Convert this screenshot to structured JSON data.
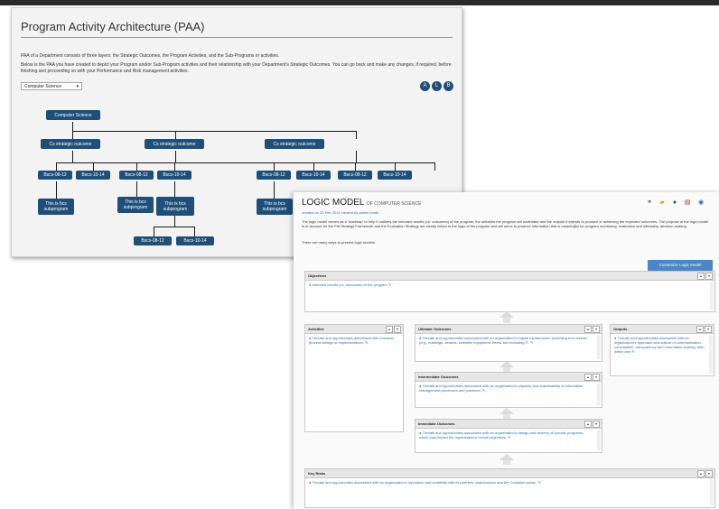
{
  "paa": {
    "title": "Program Activity Architecture (PAA)",
    "desc1": "PAA of a Department consists of three layers: the Strategic Outcomes, the Program Activities, and the Sub-Programs or activities.",
    "desc2": "Below is the PAA you have created to depict your Program and/or Sub-Program activities and their relationship with your Department's Strategic Outcomes. You can go back and make any changes, if required, before finishing and proceeding on with your Performance and Risk management activities.",
    "select_value": "Computer Science",
    "buttons": [
      "A",
      "L",
      "B"
    ],
    "nodes": {
      "root": "Computer Science",
      "outcomes": [
        "Cs strategic outcome",
        "Cs strategic outcome",
        "Cs strategic outcome"
      ],
      "bscs_0812": "Bscs-08-12",
      "bscs_1014": "Bscs-10-14",
      "subprogram": "This is bcs subprogram"
    }
  },
  "logic_model": {
    "title": "LOGIC MODEL",
    "title_suffix": "OF COMPUTER SCIENCE",
    "meta": "created on 20 Feb 2014 created by admin email",
    "intro": "The logic model serves as a 'roadmap' to help it outlines the intended results (i.e. outcomes) of the program, the activities the program will undertake and the outputs it intends to produce in achieving the expected outcomes. The purpose of the logic model is to account for the PIA Strategy Framework and the Evaluation Strategy are clearly linked to the logic of the program and will serve to produce information that is meaningful for program monitoring, evaluation and ultimately, decision-making.",
    "note": "There are many ways to present logic models.",
    "customize_button": "Customize Logic Model",
    "boxes": {
      "objectives": {
        "label": "Objectives",
        "text": "Intended results (i.e. outcomes) of the program"
      },
      "activities": {
        "label": "Activities",
        "text": "Threats and opportunities associated with business process design or implementation."
      },
      "ultimate": {
        "label": "Ultimate Outcomes",
        "text": "Threats and opportunities associated with an organization's capital infrastructure (including from assets (e.g., buildings, vessels, scientific equipment, fleets, but excluding IT."
      },
      "outputs": {
        "label": "Outputs",
        "text": "Threats and opportunities associated with an organization's approach and culture of communication, consultation, transparency and information sharing, both within and"
      },
      "intermediate": {
        "label": "Intermediate Outcomes",
        "text": "Threats and opportunities associated with an organization's capacity and sustainability of information management processes and practices."
      },
      "immediate": {
        "label": "Immediate Outcomes",
        "text": "Threats and opportunities associated with an organization's design and delivery of specific programs, which may impact the organization's overall objectives."
      },
      "key_risks": {
        "label": "Key Risks",
        "text": "Threats and opportunities associated with an organization's reputation and credibility with its partners, stakeholders and the Canadian public."
      }
    }
  },
  "colors": {
    "node": "#1f4e79",
    "link": "#2a6db5",
    "accent_button": "#4a86c8"
  }
}
